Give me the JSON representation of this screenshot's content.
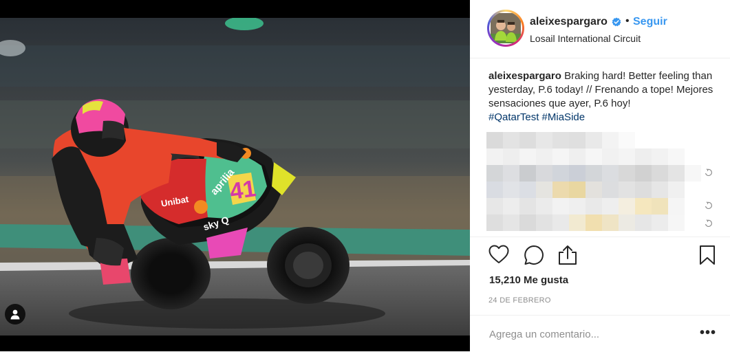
{
  "post": {
    "username": "aleixespargaro",
    "follow_label": "Seguir",
    "location": "Losail International Circuit",
    "caption": {
      "username": "aleixespargaro",
      "text": "Braking hard! Better feeling than yesterday, P.6 today! // Frenando a tope! Mejores sensaciones que ayer, P.6 hoy!",
      "hashtags": [
        "#QatarTest",
        "#MiaSide"
      ]
    },
    "likes": "15,210 Me gusta",
    "date": "24 DE FEBRERO",
    "comment_placeholder": "Agrega un comentario...",
    "more_label": "•••"
  },
  "icons": {
    "verified": "verified-badge-icon",
    "like": "heart-icon",
    "comment": "comment-bubble-icon",
    "share": "share-icon",
    "save": "bookmark-icon",
    "user_tags": "user-tag-icon",
    "reply": "reply-icon"
  },
  "colors": {
    "follow": "#3897f0",
    "hashtag": "#003569",
    "verified": "#3897f0",
    "muted": "#8e8e8e"
  }
}
